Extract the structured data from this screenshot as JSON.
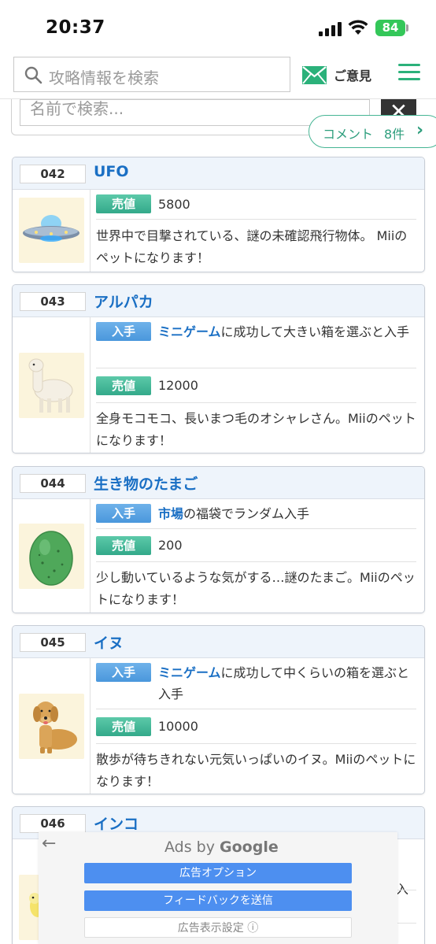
{
  "status_bar": {
    "time": "20:37",
    "battery": "84"
  },
  "header": {
    "search_placeholder": "攻略情報を検索",
    "feedback_label": "ご意見"
  },
  "name_search": {
    "placeholder": "名前で検索...",
    "clear_label": "✕"
  },
  "comments": {
    "label": "コメント",
    "count": "8件",
    "chevron": "›"
  },
  "items": [
    {
      "number": "042",
      "name": "UFO",
      "sell_label": "売値",
      "sell_value": "5800",
      "description": "世界中で目撃されている、謎の未確認飛行物体。 Miiのペットになります！"
    },
    {
      "number": "043",
      "name": "アルパカ",
      "obtain_label": "入手",
      "obtain_link": "ミニゲーム",
      "obtain_text": "に成功して大きい箱を選ぶと入手",
      "sell_label": "売値",
      "sell_value": "12000",
      "description": "全身モコモコ、長いまつ毛のオシャレさん。Miiのペットになります！"
    },
    {
      "number": "044",
      "name": "生き物のたまご",
      "obtain_label": "入手",
      "obtain_link": "市場",
      "obtain_text": "の福袋でランダム入手",
      "sell_label": "売値",
      "sell_value": "200",
      "description": "少し動いているような気がする…謎のたまご。Miiのペットになります！"
    },
    {
      "number": "045",
      "name": "イヌ",
      "obtain_label": "入手",
      "obtain_link": "ミニゲーム",
      "obtain_text": "に成功して中くらいの箱を選ぶと入手",
      "sell_label": "売値",
      "sell_value": "10000",
      "description": "散歩が待ちきれない元気いっぱいのイヌ。Miiのペットになります！"
    },
    {
      "number": "046",
      "name": "インコ",
      "obtain_partial": "入"
    }
  ],
  "ads": {
    "back_label": "←",
    "ads_by": "Ads by",
    "google": "Google",
    "option_label": "広告オプション",
    "feedback_label": "フィードバックを送信",
    "settings_label": "広告表示設定 ⓘ"
  },
  "colors": {
    "accent_green": "#2bb17a",
    "link_blue": "#1a6fc4",
    "badge_blue": "#4a97dc",
    "badge_green": "#33a98a",
    "battery_green": "#34c759"
  }
}
